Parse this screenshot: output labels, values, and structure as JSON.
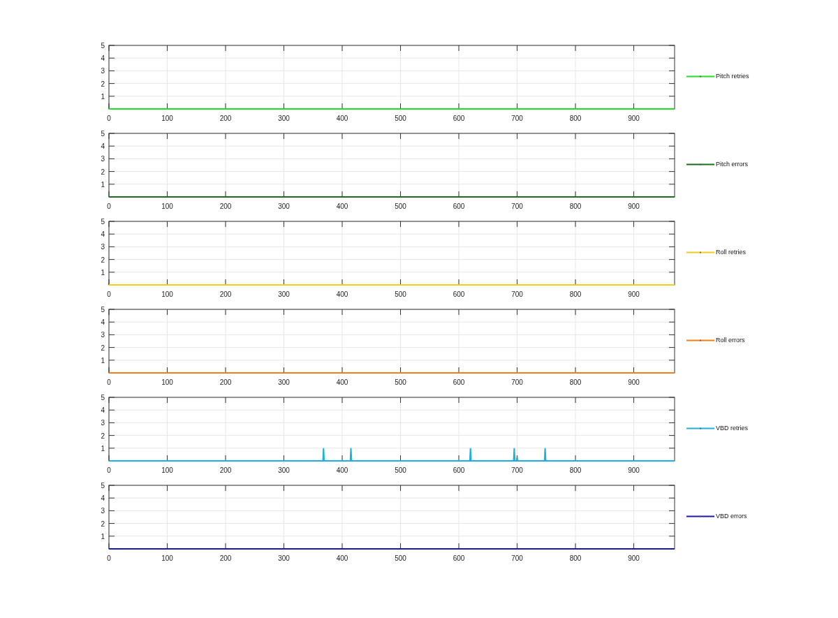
{
  "charts": [
    {
      "chart_data": {
        "type": "line",
        "grid": true,
        "xlim": [
          0,
          970
        ],
        "ylim": [
          0,
          5
        ],
        "xticks": [
          0,
          100,
          200,
          300,
          400,
          500,
          600,
          700,
          800,
          900
        ],
        "yticks": [
          1,
          2,
          3,
          4,
          5
        ],
        "x": [
          0,
          970
        ],
        "series": [
          {
            "name": "Pitch retries",
            "color": "#22dd22",
            "values": [
              0,
              0
            ]
          }
        ]
      }
    },
    {
      "chart_data": {
        "type": "line",
        "grid": true,
        "xlim": [
          0,
          970
        ],
        "ylim": [
          0,
          5
        ],
        "xticks": [
          0,
          100,
          200,
          300,
          400,
          500,
          600,
          700,
          800,
          900
        ],
        "yticks": [
          1,
          2,
          3,
          4,
          5
        ],
        "x": [
          0,
          970
        ],
        "series": [
          {
            "name": "Pitch errors",
            "color": "#1a6e1a",
            "values": [
              0,
              0
            ]
          }
        ]
      }
    },
    {
      "chart_data": {
        "type": "line",
        "grid": true,
        "xlim": [
          0,
          970
        ],
        "ylim": [
          0,
          5
        ],
        "xticks": [
          0,
          100,
          200,
          300,
          400,
          500,
          600,
          700,
          800,
          900
        ],
        "yticks": [
          1,
          2,
          3,
          4,
          5
        ],
        "x": [
          0,
          970
        ],
        "series": [
          {
            "name": "Roll retries",
            "color": "#f2cc1a",
            "values": [
              0,
              0
            ]
          }
        ]
      }
    },
    {
      "chart_data": {
        "type": "line",
        "grid": true,
        "xlim": [
          0,
          970
        ],
        "ylim": [
          0,
          5
        ],
        "xticks": [
          0,
          100,
          200,
          300,
          400,
          500,
          600,
          700,
          800,
          900
        ],
        "yticks": [
          1,
          2,
          3,
          4,
          5
        ],
        "x": [
          0,
          970
        ],
        "series": [
          {
            "name": "Roll errors",
            "color": "#ee7f1a",
            "values": [
              0,
              0
            ]
          }
        ]
      }
    },
    {
      "chart_data": {
        "type": "line",
        "grid": true,
        "xlim": [
          0,
          970
        ],
        "ylim": [
          0,
          5
        ],
        "xticks": [
          0,
          100,
          200,
          300,
          400,
          500,
          600,
          700,
          800,
          900
        ],
        "yticks": [
          1,
          2,
          3,
          4,
          5
        ],
        "x": [
          0,
          367,
          368,
          369,
          414,
          415,
          416,
          619,
          620,
          621,
          694,
          695,
          696,
          699,
          700,
          701,
          747,
          748,
          749,
          970
        ],
        "series": [
          {
            "name": "VBD retries",
            "color": "#1fb0e0",
            "values": [
              0,
              0,
              1,
              0,
              0,
              1,
              0,
              0,
              1,
              0,
              0,
              1,
              0,
              0,
              0.3,
              0,
              0,
              1,
              0,
              0
            ]
          }
        ]
      }
    },
    {
      "chart_data": {
        "type": "line",
        "grid": true,
        "xlim": [
          0,
          970
        ],
        "ylim": [
          0,
          5
        ],
        "xticks": [
          0,
          100,
          200,
          300,
          400,
          500,
          600,
          700,
          800,
          900
        ],
        "yticks": [
          1,
          2,
          3,
          4,
          5
        ],
        "x": [
          0,
          970
        ],
        "series": [
          {
            "name": "VBD errors",
            "color": "#1a1aa8",
            "values": [
              0,
              0
            ]
          }
        ]
      }
    }
  ]
}
